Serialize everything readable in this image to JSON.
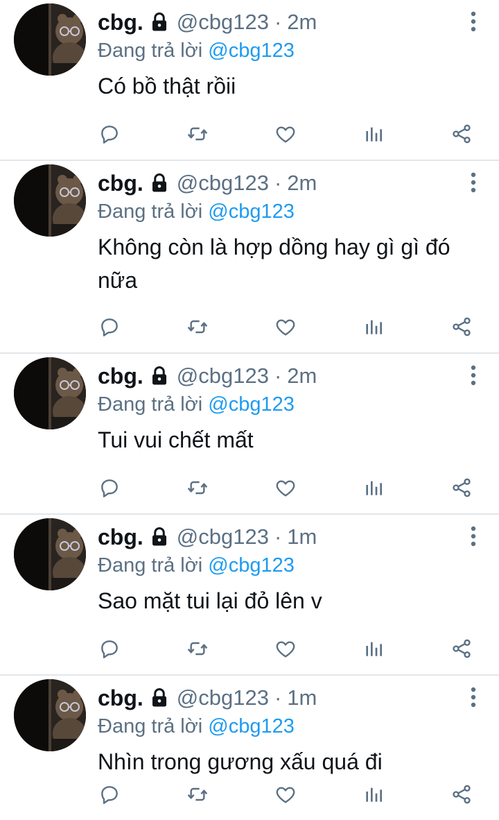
{
  "colors": {
    "text": "#0f1419",
    "secondary": "#5b7083",
    "mention": "#1d9bf0",
    "divider": "#e3e6ea"
  },
  "tweets": [
    {
      "display_name": "cbg.",
      "handle": "@cbg123",
      "separator": "·",
      "time": "2m",
      "reply_prefix": "Đang trả lời",
      "reply_to": "@cbg123",
      "text": "Có bồ thật rồii",
      "icons": [
        "lock-icon",
        "more-icon",
        "reply-icon",
        "retweet-icon",
        "like-icon",
        "analytics-icon",
        "share-icon"
      ]
    },
    {
      "display_name": "cbg.",
      "handle": "@cbg123",
      "separator": "·",
      "time": "2m",
      "reply_prefix": "Đang trả lời",
      "reply_to": "@cbg123",
      "text": "Không còn là hợp dồng hay gì gì đó nữa",
      "icons": [
        "lock-icon",
        "more-icon",
        "reply-icon",
        "retweet-icon",
        "like-icon",
        "analytics-icon",
        "share-icon"
      ]
    },
    {
      "display_name": "cbg.",
      "handle": "@cbg123",
      "separator": "·",
      "time": "2m",
      "reply_prefix": "Đang trả lời",
      "reply_to": "@cbg123",
      "text": "Tui vui chết mất",
      "icons": [
        "lock-icon",
        "more-icon",
        "reply-icon",
        "retweet-icon",
        "like-icon",
        "analytics-icon",
        "share-icon"
      ]
    },
    {
      "display_name": "cbg.",
      "handle": "@cbg123",
      "separator": "·",
      "time": "1m",
      "reply_prefix": "Đang trả lời",
      "reply_to": "@cbg123",
      "text": "Sao mặt tui lại đỏ lên v",
      "icons": [
        "lock-icon",
        "more-icon",
        "reply-icon",
        "retweet-icon",
        "like-icon",
        "analytics-icon",
        "share-icon"
      ]
    },
    {
      "display_name": "cbg.",
      "handle": "@cbg123",
      "separator": "·",
      "time": "1m",
      "reply_prefix": "Đang trả lời",
      "reply_to": "@cbg123",
      "text": "Nhìn trong gương xấu quá đi",
      "icons": [
        "lock-icon",
        "more-icon",
        "reply-icon",
        "retweet-icon",
        "like-icon",
        "analytics-icon",
        "share-icon"
      ]
    }
  ]
}
